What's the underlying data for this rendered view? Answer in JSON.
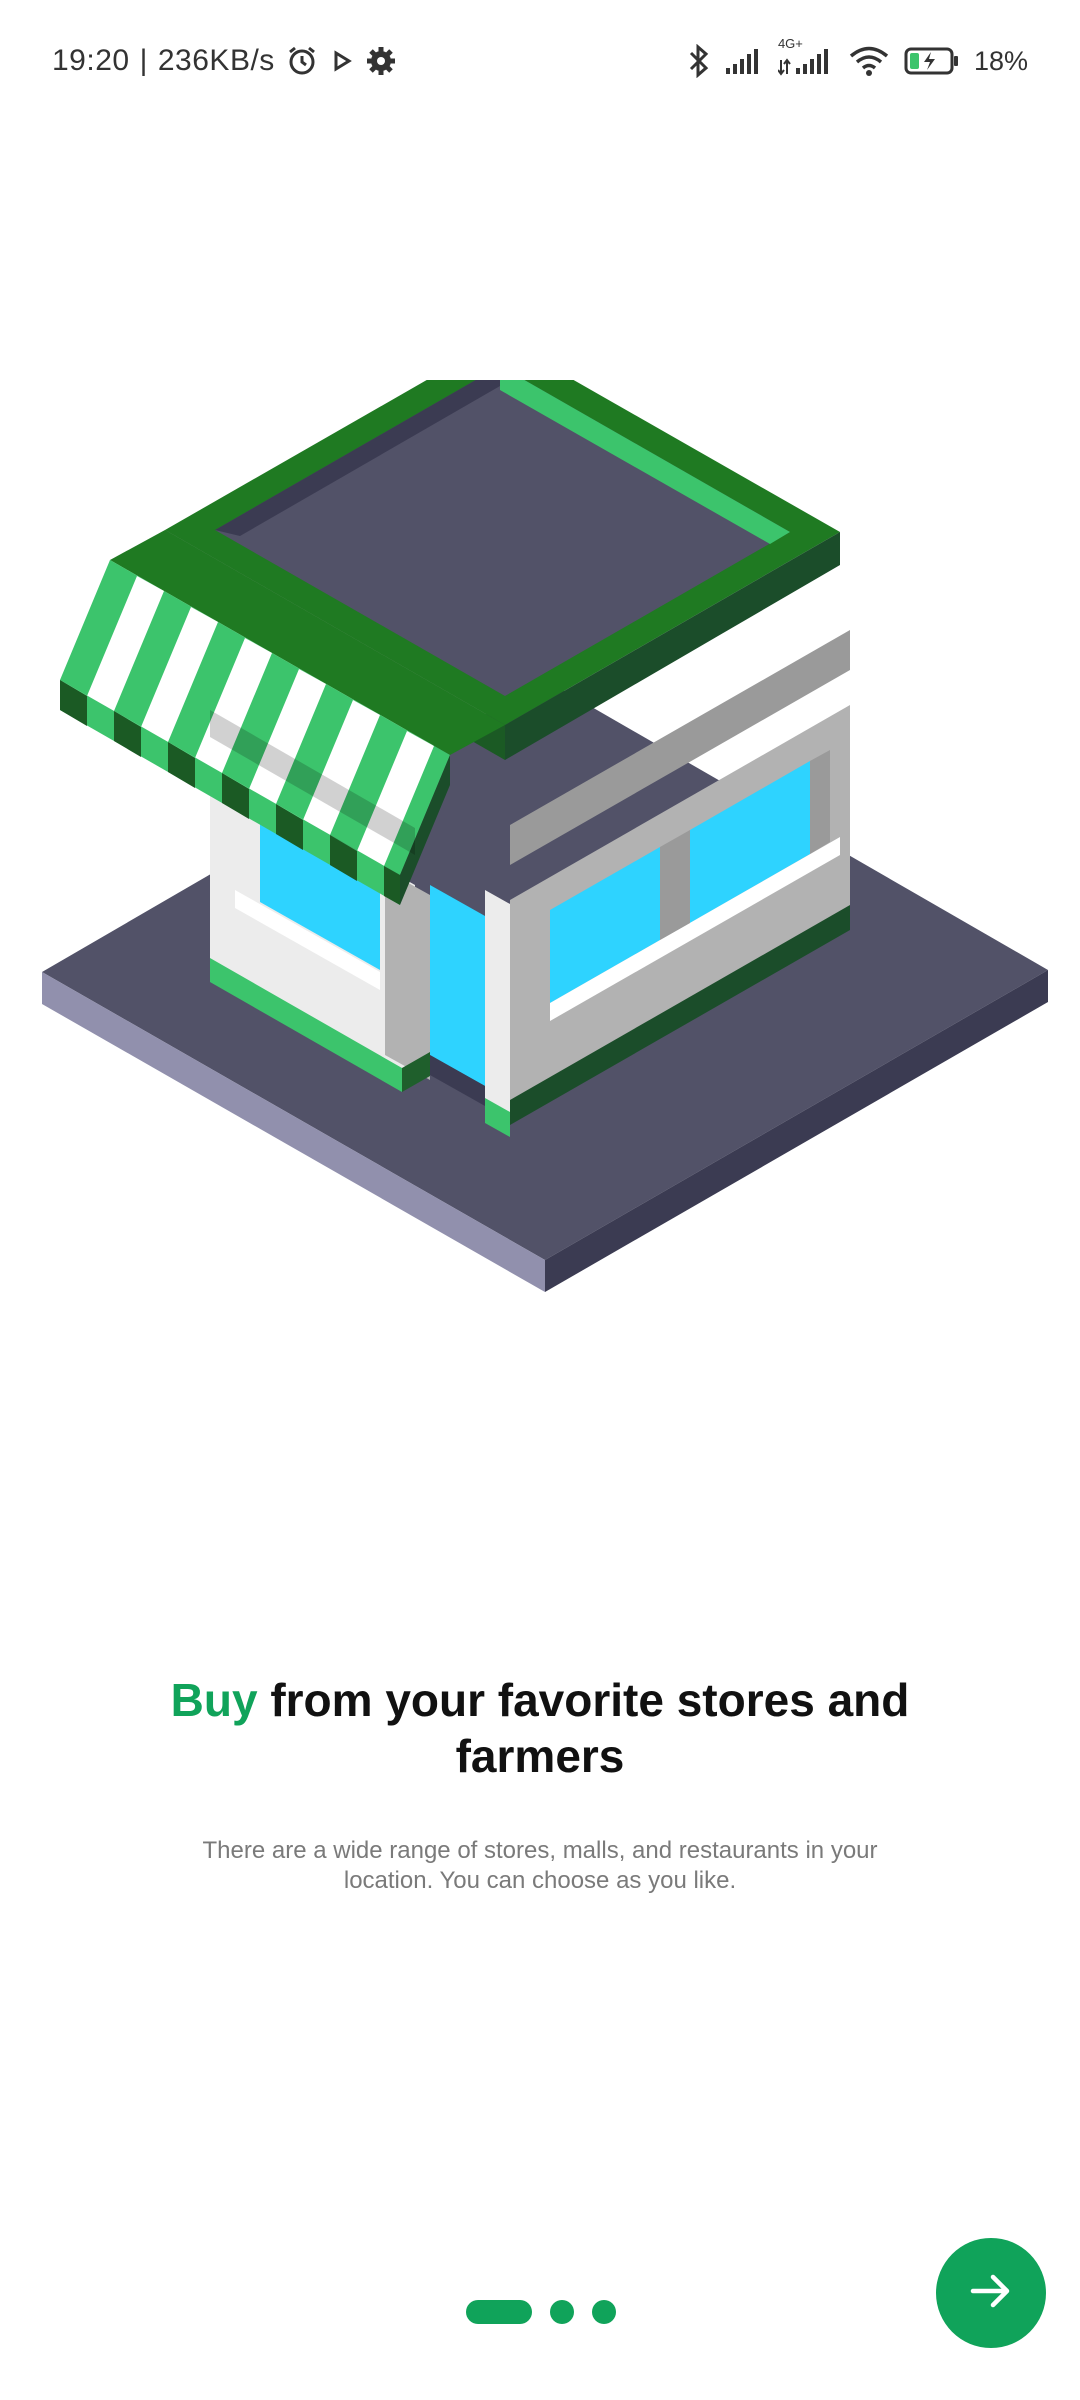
{
  "status_bar": {
    "time": "19:20",
    "separator": "|",
    "speed": "236KB/s",
    "left_icons": [
      "alarm-icon",
      "play-icon",
      "gear-icon"
    ],
    "right_icons": [
      "bluetooth-icon",
      "signal-icon",
      "signal-4g-icon",
      "wifi-icon",
      "battery-icon"
    ],
    "network_label": "4G+",
    "battery": "18%"
  },
  "onboarding": {
    "headline_accent": "Buy",
    "headline_rest": "from your favorite stores and farmers",
    "description": "There are a wide range of stores, malls, and restaurants in your location. You can choose as you like.",
    "illustration_icon": "store-illustration",
    "next_icon": "arrow-right-icon",
    "pager": {
      "pages": 3,
      "current": 1
    }
  },
  "colors": {
    "accent": "#10A35A",
    "roof_green_dark": "#1F7A22",
    "roof_green_light": "#3CC46C",
    "window_blue": "#2ED3FF",
    "base_dark": "#525268"
  }
}
